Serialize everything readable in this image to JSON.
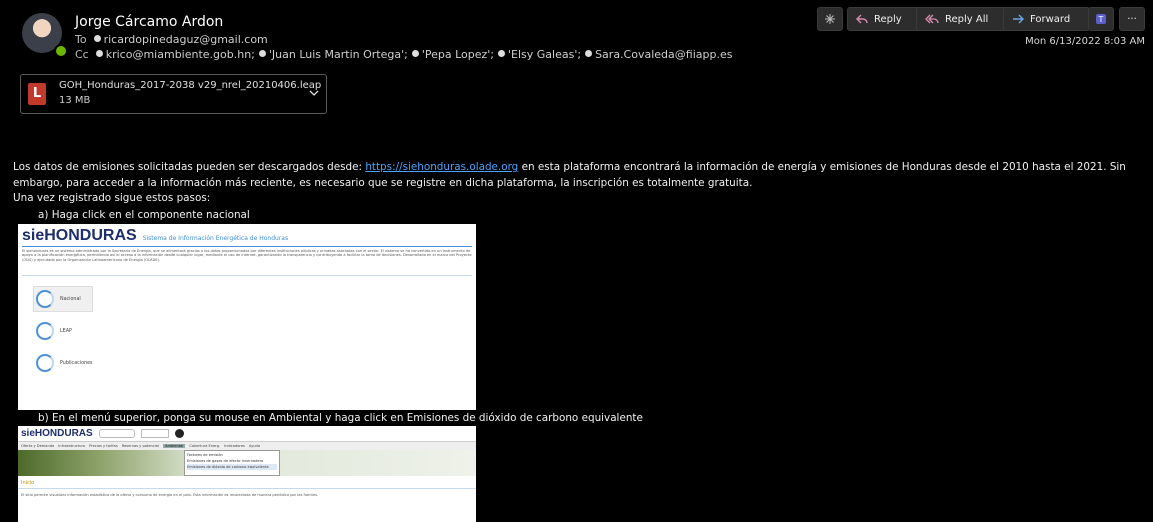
{
  "email": {
    "sender": "Jorge Cárcamo Ardon",
    "to_label": "To",
    "to": "ricardopinedaguz@gmail.com",
    "cc_label": "Cc",
    "cc": [
      "krico@miambiente.gob.hn;",
      "'Juan Luis Martin Ortega';",
      "'Pepa Lopez';",
      "'Elsy Galeas';",
      "Sara.Covaleda@fiiapp.es"
    ],
    "date": "Mon 6/13/2022 8:03 AM"
  },
  "toolbar": {
    "reply": "Reply",
    "reply_all": "Reply All",
    "forward": "Forward",
    "more": "···"
  },
  "attachment": {
    "icon_letter": "L",
    "name": "GOH_Honduras_2017-2038 v29_nrel_20210406.leap",
    "size": "13 MB"
  },
  "body": {
    "p1_a": "Los datos de emisiones solicitadas pueden ser descargados desde: ",
    "link": "https://siehonduras.olade.org",
    "p1_b": " en esta plataforma encontrará la información de energía y emisiones de Honduras desde el 2010 hasta el 2021. Sin embargo, para acceder a la información más reciente, es necesario que se registre en dicha plataforma, la inscripción es totalmente gratuita.",
    "p2": "Una vez registrado sigue estos pasos:",
    "step_a": "a)   Haga click en el componente nacional",
    "step_b": "b)   En el menú superior, ponga su mouse en Ambiental y haga click en Emisiones de dióxido de carbono equivalente"
  },
  "screenshot1": {
    "logo": "sieHONDURAS",
    "subtitle": "Sistema de Información Energética de Honduras",
    "intro": "El siehonduras es un sistema administrado por la Secretaría de Energía, que se alimentará gracias a los datos proporcionados por diferentes instituciones públicas y privadas asociadas con el sector. El sistema se ha convertido en un instrumento de apoyo a la planificación energética, permitiendo así el acceso a la información desde cualquier lugar, mediante el uso de internet, garantizando la transparencia y contribuyendo a facilitar la toma de decisiones. Desarrollado en el marco del Proyecto (ODS) y ejecutado por la Organización Latinoamericana de Energía (OLADE).",
    "items": [
      "Nacional",
      "LEAP",
      "Publicaciones"
    ]
  },
  "screenshot2": {
    "logo": "sieHONDURAS",
    "menu": [
      "Oferta y Demanda",
      "Infraestructura",
      "Precios y tarifas",
      "Reservas y potencial",
      "Ambiental",
      "Cobertura Energ.",
      "Indicadores",
      "Ayuda"
    ],
    "dropdown": [
      "Factores de emisión",
      "Emisiones de gases de efecto invernadero",
      "Emisiones de dióxido de carbono equivalente"
    ],
    "section": "Inicio",
    "text": "El sitio permite visualizar información estadística de la oferta y consumo de energía en el país. Esta información es recolectada de manera periódica por las fuentes."
  },
  "colors": {
    "link": "#4aa3ff",
    "accent": "#1d2e6b",
    "presence": "#6bb700"
  }
}
